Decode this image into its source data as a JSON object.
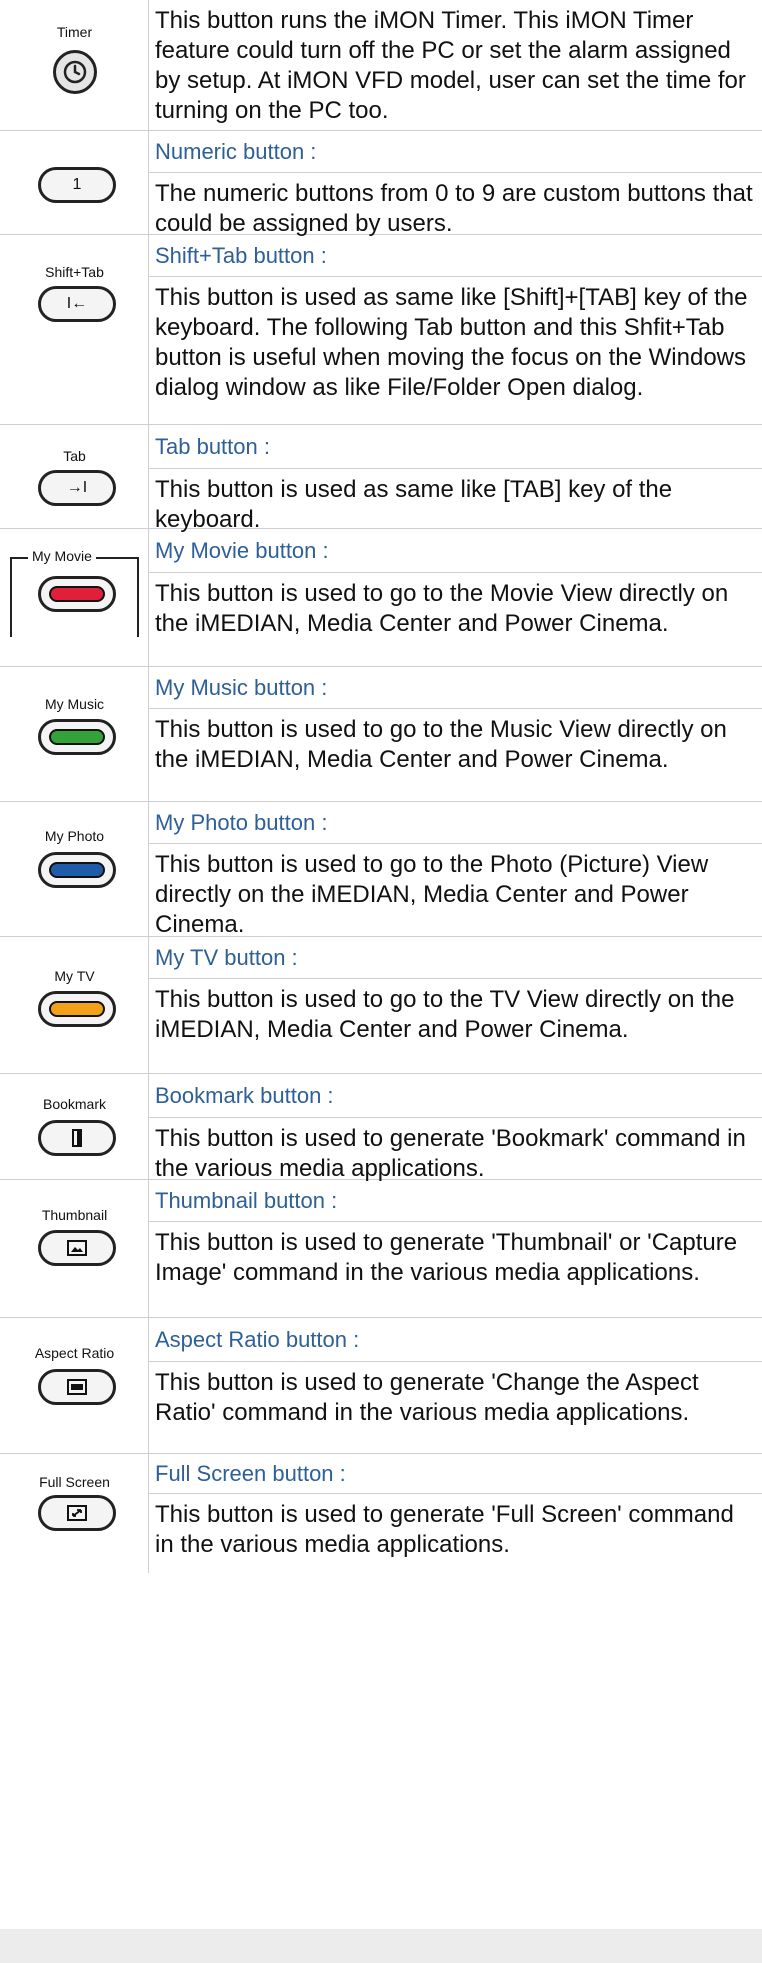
{
  "rows": [
    {
      "icon_label": "Timer",
      "title": "",
      "body": "This button runs the iMON Timer. This iMON Timer feature could turn off the PC or set the alarm assigned by setup. At iMON VFD model, user can set the time for turning on the PC too."
    },
    {
      "icon_label": "",
      "button_text": "1",
      "title": "Numeric button :",
      "body": "The numeric buttons from 0 to 9 are custom buttons that could be assigned by users."
    },
    {
      "icon_label": "Shift+Tab",
      "button_text": "I←",
      "title": "Shift+Tab button :",
      "body": "This button is used as same like [Shift]+[TAB] key of the keyboard. The following Tab button and this Shfit+Tab button is useful when moving the focus on the Windows dialog window as like File/Folder Open dialog."
    },
    {
      "icon_label": "Tab",
      "button_text": "→I",
      "title": "Tab button :",
      "body": "This button is used as same like [TAB] key of the keyboard."
    },
    {
      "icon_label": "My Movie",
      "title": "My Movie button :",
      "body": "This button is used to go to the Movie View directly on the iMEDIAN, Media Center and Power Cinema."
    },
    {
      "icon_label": "My Music",
      "title": "My Music button :",
      "body": "This button is used to go to the Music View directly on the iMEDIAN, Media Center and Power Cinema."
    },
    {
      "icon_label": "My Photo",
      "title": "My Photo button :",
      "body": "This button is used to go to the Photo (Picture) View directly on the iMEDIAN, Media Center and Power Cinema."
    },
    {
      "icon_label": "My TV",
      "title": "My TV button :",
      "body": "This button is used to go to the TV View directly on the iMEDIAN, Media Center and Power Cinema."
    },
    {
      "icon_label": "Bookmark",
      "title": "Bookmark button :",
      "body": "This button is used to generate 'Bookmark' command in the various media applications."
    },
    {
      "icon_label": "Thumbnail",
      "title": "Thumbnail button :",
      "body": "This button is used to generate 'Thumbnail' or 'Capture Image' command in the various media applications."
    },
    {
      "icon_label": "Aspect Ratio",
      "title": "Aspect Ratio button :",
      "body": "This button is used to generate 'Change the Aspect Ratio' command in the various media applications."
    },
    {
      "icon_label": "Full Screen",
      "title": "Full Screen button :",
      "body": "This button is used to generate 'Full Screen' command in the various media applications."
    }
  ],
  "colors": {
    "title_blue": "#2e5f96",
    "movie": "#e0203a",
    "music": "#33a23a",
    "photo": "#1e5ba8",
    "tv": "#f4a11a"
  },
  "icons": [
    "clock-icon",
    "bookmark-icon",
    "thumbnail-icon",
    "aspect-ratio-icon",
    "full-screen-icon"
  ]
}
